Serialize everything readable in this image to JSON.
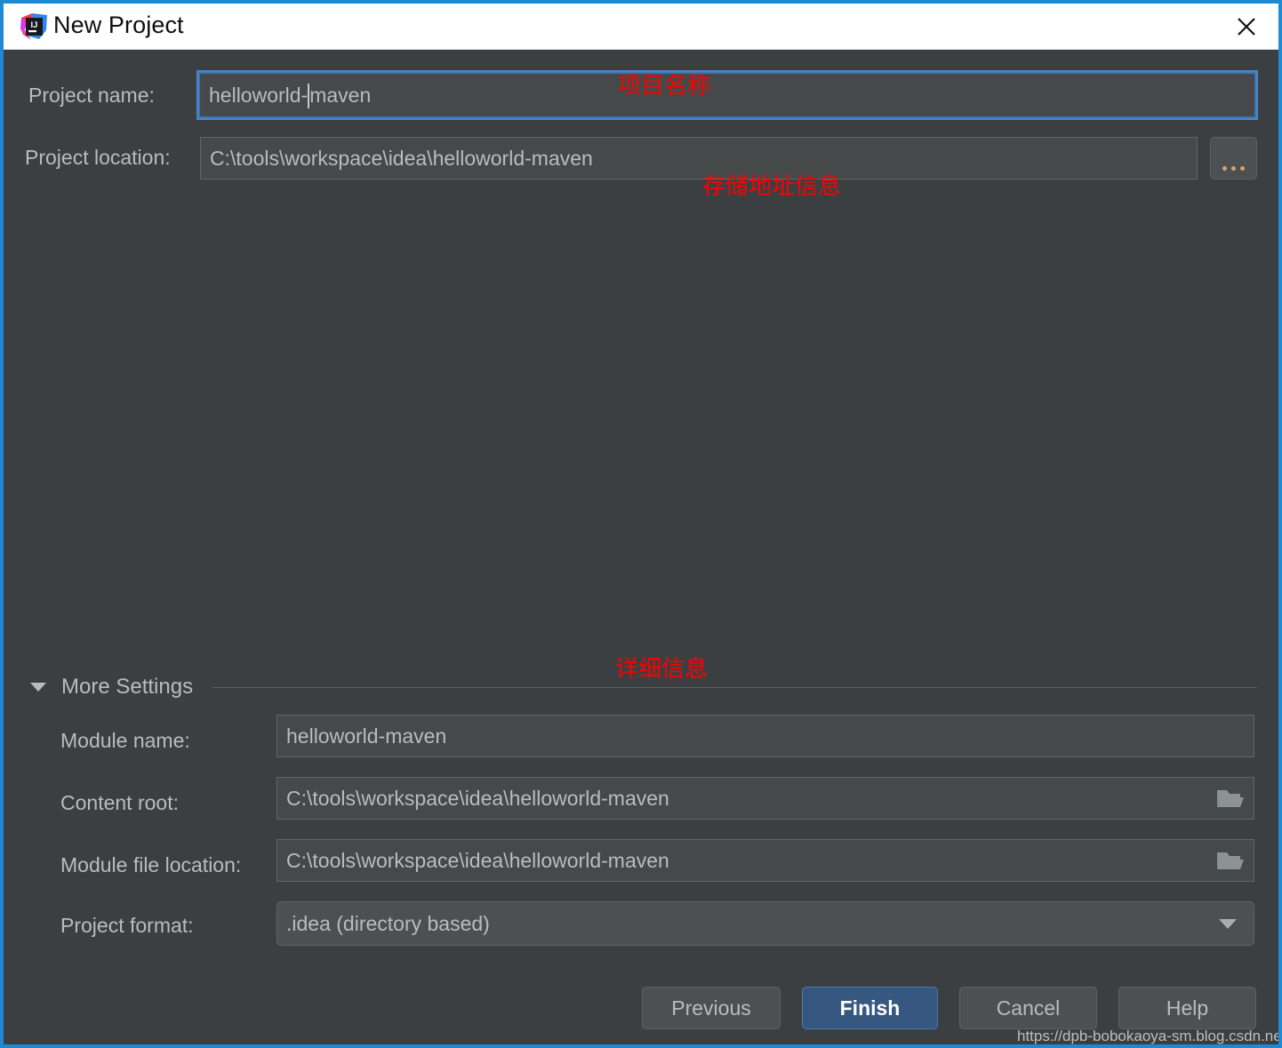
{
  "window": {
    "title": "New Project",
    "logo_icon": "intellij-idea-logo",
    "close_icon": "close-icon",
    "border_color": "#1e8ad6",
    "background": "#3c3f41",
    "titlebar_background": "#ffffff"
  },
  "top_form": {
    "project_name": {
      "label": "Project name:",
      "value_before_caret": "helloworld-",
      "value_after_caret": "maven",
      "full_value": "helloworld-maven",
      "placeholder": "",
      "focused": true
    },
    "project_location": {
      "label": "Project location:",
      "value": "C:\\tools\\workspace\\idea\\helloworld-maven",
      "placeholder": "",
      "browse_icon": "ellipsis-icon",
      "browse_label": "..."
    }
  },
  "more_settings": {
    "label": "More Settings",
    "expanded": true,
    "toggle_icon": "chevron-down-icon",
    "fields": [
      {
        "label": "Module name:",
        "value": "helloworld-maven",
        "trailing_icon": null,
        "type": "text"
      },
      {
        "label": "Content root:",
        "value": "C:\\tools\\workspace\\idea\\helloworld-maven",
        "trailing_icon": "folder-icon",
        "type": "text"
      },
      {
        "label": "Module file location:",
        "value": "C:\\tools\\workspace\\idea\\helloworld-maven",
        "trailing_icon": "folder-icon",
        "type": "text"
      },
      {
        "label": "Project format:",
        "value": ".idea (directory based)",
        "trailing_icon": "chevron-down-icon",
        "type": "combobox"
      }
    ]
  },
  "buttons": {
    "previous": "Previous",
    "finish": "Finish",
    "cancel": "Cancel",
    "help": "Help",
    "primary_color": "#365880"
  },
  "annotations": [
    {
      "text": "项目名称",
      "color": "#ff0000"
    },
    {
      "text": "存储地址信息",
      "color": "#ff0000"
    },
    {
      "text": "详细信息",
      "color": "#ff0000"
    }
  ],
  "watermark": "https://dpb-bobokaoya-sm.blog.csdn.net"
}
